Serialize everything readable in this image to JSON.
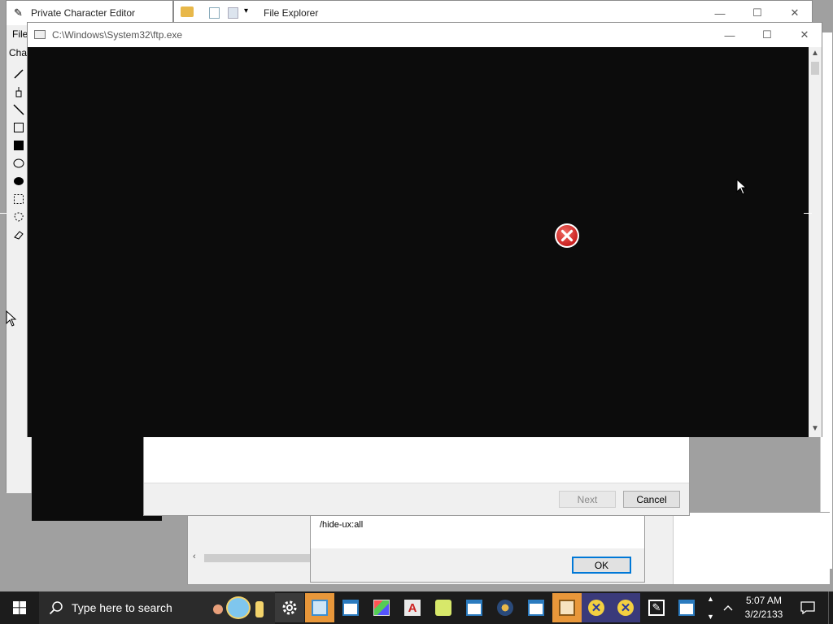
{
  "pce_window": {
    "title": "Private Character Editor",
    "menu_file": "File",
    "char_label": "Char"
  },
  "explorer_window": {
    "title": "File Explorer"
  },
  "wizard": {
    "next_label": "Next",
    "cancel_label": "Cancel"
  },
  "message_box": {
    "partial_text": "/hide-ux:all",
    "ok_label": "OK"
  },
  "console": {
    "title": "C:\\Windows\\System32\\ftp.exe",
    "error_icon": "error-icon",
    "background_color": "#0c0c0c"
  },
  "taskbar": {
    "search_placeholder": "Type here to search",
    "time": "5:07 AM",
    "date": "3/2/2133",
    "apps": [
      "settings-icon",
      "control-panel-icon",
      "window-app-icon",
      "paint-icon",
      "font-viewer-icon",
      "tools-icon",
      "window-app-icon",
      "globe-icon",
      "window-app-icon",
      "media-icon",
      "x-app-icon",
      "x-app-icon",
      "pen-app-icon",
      "window-app-icon"
    ]
  },
  "colors": {
    "taskbar": "#1c1c1c",
    "active_app": "#e8973a",
    "error_red": "#d8322f"
  }
}
